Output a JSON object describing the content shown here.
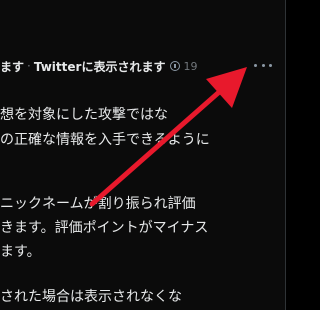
{
  "tweet": {
    "header": {
      "label_a": "ます",
      "separator": "·",
      "label_b": "Twitterに表示されます",
      "count": "19"
    },
    "body_lines": [
      "想を対象にした攻撃ではな",
      "の正確な情報を入手できるように",
      "ニックネームが割り振られ評価",
      "きます。評価ポイントがマイナス",
      "ます。",
      "された場合は表示されなくな"
    ]
  },
  "annotation": {
    "arrow_color": "#e8192c",
    "description_icon": "red-arrow"
  }
}
